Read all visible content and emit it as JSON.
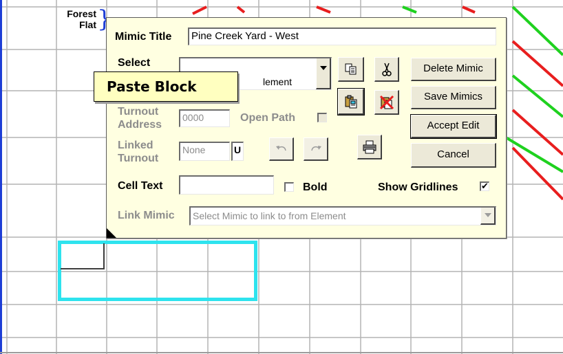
{
  "grid": {
    "line_color": "#b4b4b4",
    "left_border_color": "#1f3fd6"
  },
  "track_colors": {
    "red": "#e81e1e",
    "green": "#1fd11f"
  },
  "map_label": {
    "line1": "Forest",
    "line2": "Flat"
  },
  "dialog": {
    "mimic_title_label": "Mimic Title",
    "mimic_title_value": "Pine Creek Yard - West",
    "select_label": "Select",
    "select_value_partial": "lement",
    "turnout_address_label_1": "Turnout",
    "turnout_address_label_2": "Address",
    "turnout_address_value": "0000",
    "open_path_label": "Open Path",
    "linked_turnout_label_1": "Linked",
    "linked_turnout_label_2": "Turnout",
    "linked_turnout_value": "None",
    "linked_turnout_suffix": "U",
    "cell_text_label": "Cell Text",
    "cell_text_value": "",
    "bold_label": "Bold",
    "bold_checked": false,
    "show_gridlines_label": "Show Gridlines",
    "show_gridlines_checked": true,
    "link_mimic_label": "Link Mimic",
    "link_mimic_value": "Select Mimic to link to from Element",
    "buttons": {
      "delete_mimic": "Delete Mimic",
      "save_mimics": "Save Mimics",
      "accept_edit": "Accept Edit",
      "cancel": "Cancel"
    },
    "background": "#ffffe1"
  },
  "tooltip": {
    "text": "Paste Block"
  },
  "selection_color": "#2ee3ee"
}
